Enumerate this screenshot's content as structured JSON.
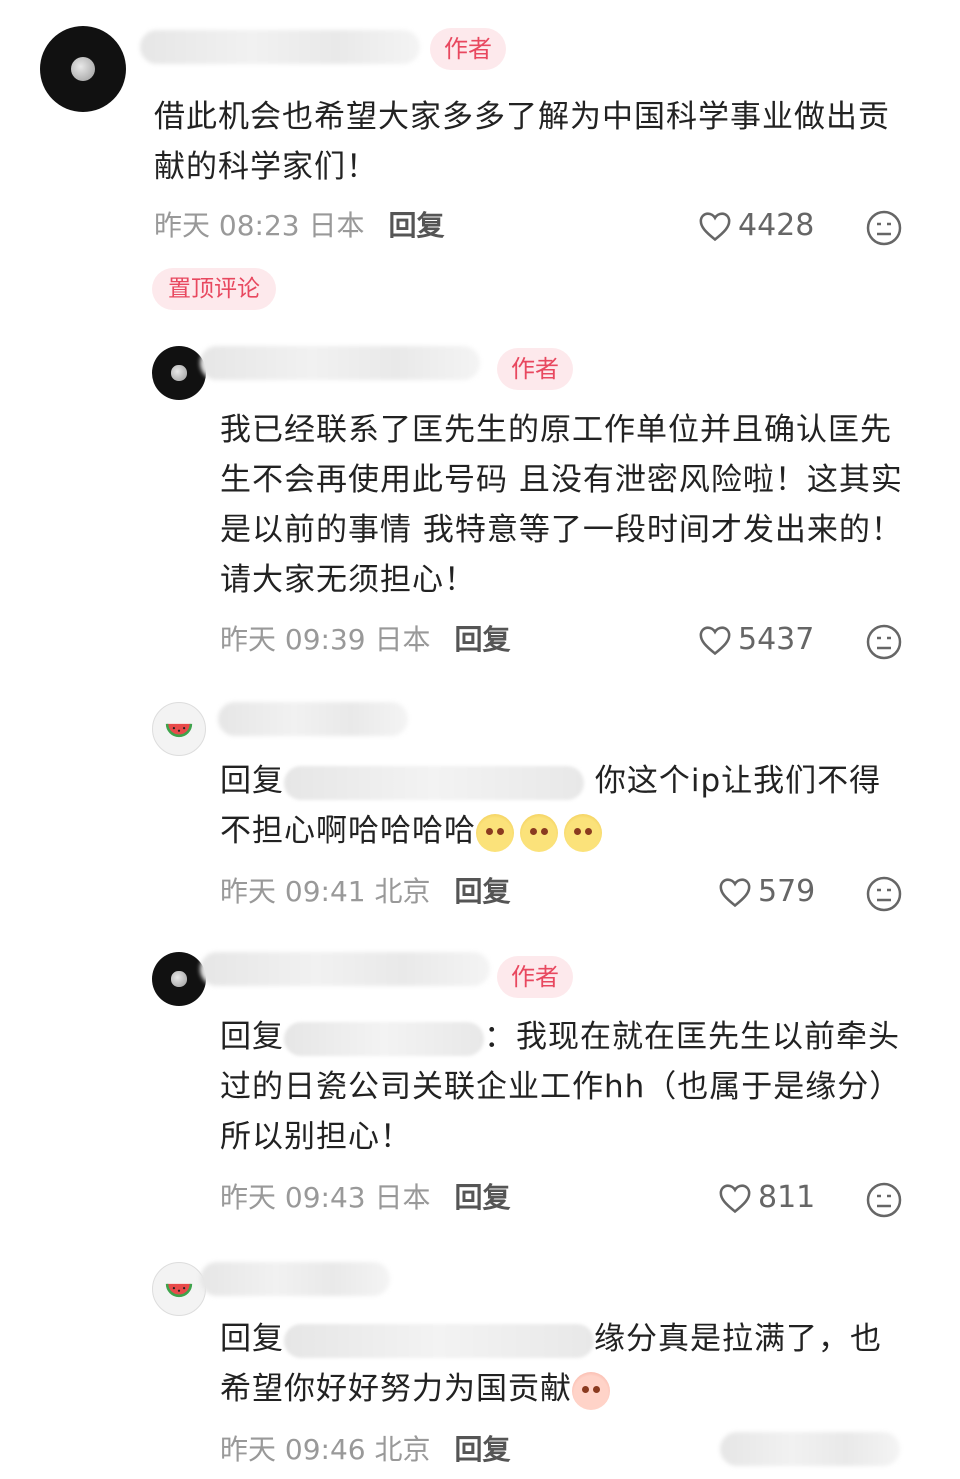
{
  "comments": [
    {
      "author_tag": "作者",
      "text": "借此机会也希望大家多多了解为中国科学事业做出贡献的科学家们！",
      "time": "昨天 08:23 日本",
      "reply_label": "回复",
      "likes": "4428",
      "pinned_label": "置顶评论"
    },
    {
      "author_tag": "作者",
      "text": "我已经联系了匡先生的原工作单位并且确认匡先生不会再使用此号码 且没有泄密风险啦！这其实是以前的事情 我特意等了一段时间才发出来的！请大家无须担心！",
      "time": "昨天 09:39 日本",
      "reply_label": "回复",
      "likes": "5437"
    },
    {
      "text_prefix": "回复",
      "text_suffix": " 你这个ip让我们不得不担心啊哈哈哈哈",
      "time": "昨天 09:41 北京",
      "reply_label": "回复",
      "likes": "579"
    },
    {
      "author_tag": "作者",
      "text_prefix": "回复",
      "text_suffix": "：我现在就在匡先生以前牵头过的日瓷公司关联企业工作hh（也属于是缘分）所以别担心！",
      "time": "昨天 09:43 日本",
      "reply_label": "回复",
      "likes": "811"
    },
    {
      "text_prefix": "回复",
      "text_suffix": "缘分真是拉满了，也希望你好好努力为国贡献",
      "time": "昨天 09:46 北京",
      "reply_label": "回复"
    }
  ],
  "icons": {
    "like": "heart-icon",
    "dislike": "dislike-face-icon",
    "avatar_moon": "moon-avatar",
    "avatar_watermelon": "watermelon-avatar"
  },
  "colors": {
    "tag_bg": "#fde9ec",
    "tag_text": "#e8485f",
    "meta_text": "#999999"
  }
}
